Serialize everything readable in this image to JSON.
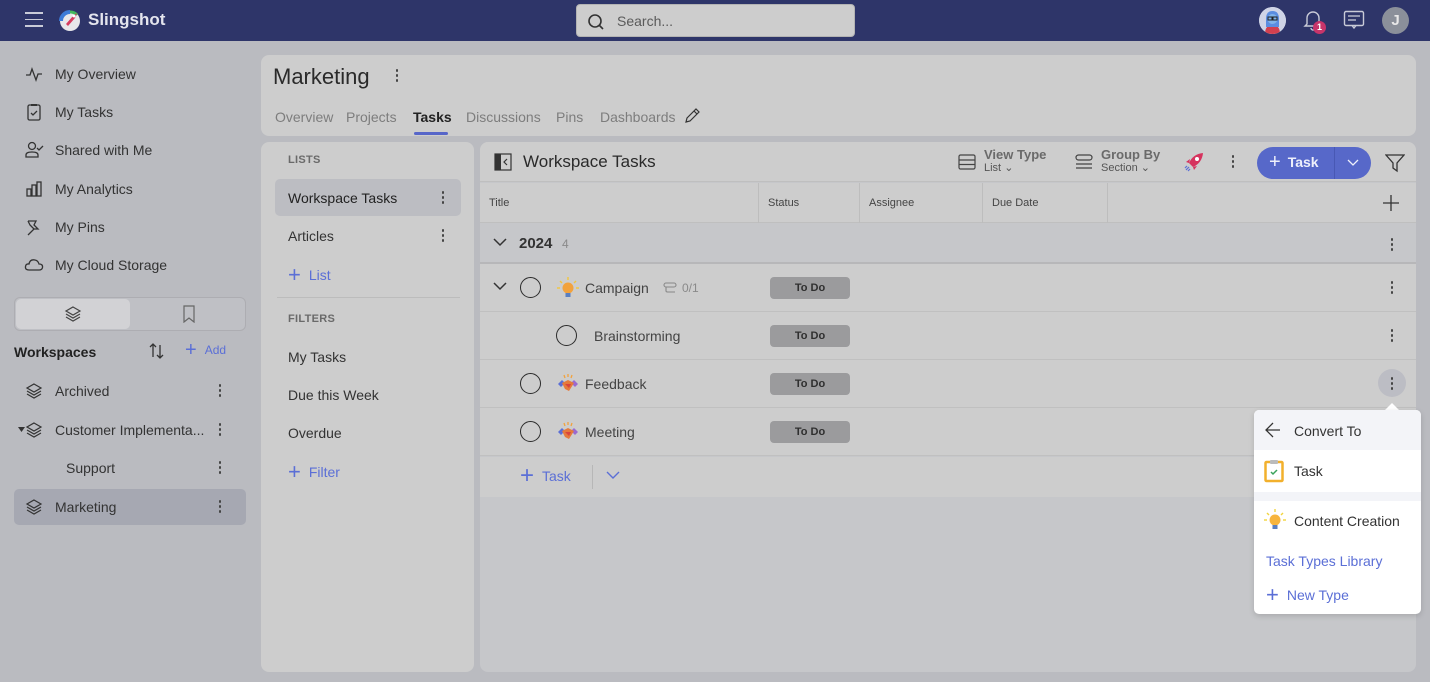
{
  "app": {
    "brand": "Slingshot",
    "search_placeholder": "Search...",
    "notification_count": "1",
    "user_initial": "J"
  },
  "sidebar": {
    "nav": [
      {
        "label": "My Overview",
        "icon": "activity-icon"
      },
      {
        "label": "My Tasks",
        "icon": "clipboard-check-icon"
      },
      {
        "label": "Shared with Me",
        "icon": "user-check-icon"
      },
      {
        "label": "My Analytics",
        "icon": "bar-chart-icon"
      },
      {
        "label": "My Pins",
        "icon": "pin-icon"
      },
      {
        "label": "My Cloud Storage",
        "icon": "cloud-icon"
      }
    ],
    "workspaces_title": "Workspaces",
    "add_label": "Add",
    "workspaces": [
      {
        "label": "Archived"
      },
      {
        "label": "Customer Implementa..."
      },
      {
        "label": "Support"
      },
      {
        "label": "Marketing",
        "active": true
      }
    ]
  },
  "header": {
    "title": "Marketing",
    "tabs": [
      {
        "label": "Overview"
      },
      {
        "label": "Projects"
      },
      {
        "label": "Tasks",
        "active": true
      },
      {
        "label": "Discussions"
      },
      {
        "label": "Pins"
      },
      {
        "label": "Dashboards"
      }
    ]
  },
  "lists_panel": {
    "lists_label": "LISTS",
    "lists": [
      {
        "label": "Workspace Tasks",
        "active": true
      },
      {
        "label": "Articles"
      }
    ],
    "add_list_label": "List",
    "filters_label": "FILTERS",
    "filters": [
      {
        "label": "My Tasks"
      },
      {
        "label": "Due this Week"
      },
      {
        "label": "Overdue"
      }
    ],
    "add_filter_label": "Filter"
  },
  "tasks_panel": {
    "title": "Workspace Tasks",
    "view_type": {
      "label": "View Type",
      "value": "List"
    },
    "group_by": {
      "label": "Group By",
      "value": "Section"
    },
    "add_task_label": "Task",
    "columns": [
      "Title",
      "Status",
      "Assignee",
      "Due Date"
    ],
    "group": {
      "title": "2024",
      "count": "4"
    },
    "tasks": [
      {
        "name": "Campaign",
        "type": "lightbulb",
        "subtasks": "0/1",
        "status": "To Do",
        "expandable": true
      },
      {
        "name": "Brainstorming",
        "type": "none",
        "status": "To Do",
        "subtask": true
      },
      {
        "name": "Feedback",
        "type": "handshake",
        "status": "To Do"
      },
      {
        "name": "Meeting",
        "type": "handshake",
        "status": "To Do"
      }
    ],
    "add_row_label": "Task"
  },
  "convert_menu": {
    "header": "Convert To",
    "items": [
      {
        "label": "Task",
        "icon": "clipboard-task-icon"
      },
      {
        "label": "Content Creation",
        "icon": "lightbulb-icon"
      }
    ],
    "library_label": "Task Types Library",
    "new_type_label": "New Type"
  },
  "colors": {
    "topbar": "#2e3569",
    "accent": "#5768c9",
    "link": "#5b6fd6",
    "badge": "#c7356a",
    "status_pill": "#9b9b9d"
  }
}
